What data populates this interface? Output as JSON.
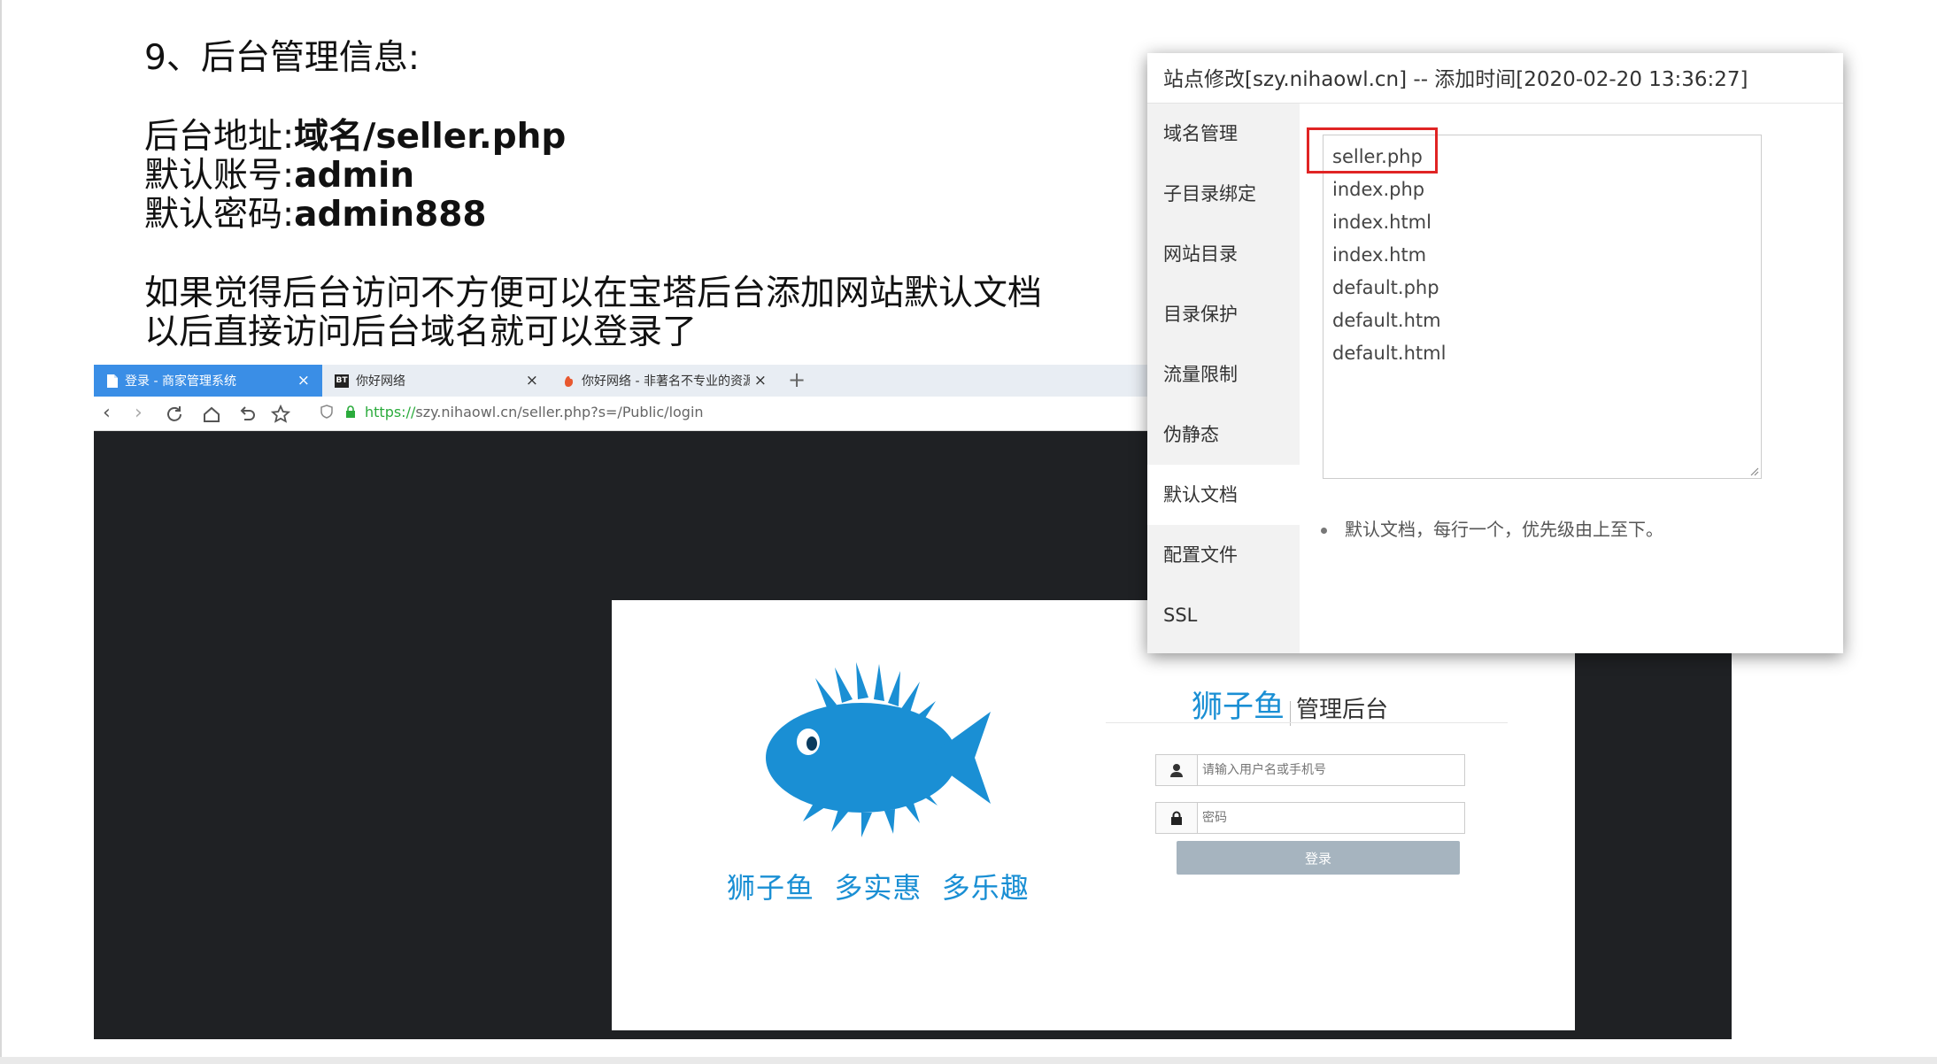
{
  "instructions": {
    "heading": "9、后台管理信息:",
    "address_label": "后台地址:",
    "address_value": "域名/seller.php",
    "account_label": "默认账号:",
    "account_value": "admin",
    "password_label": "默认密码:",
    "password_value": "admin888",
    "tip_line1": "如果觉得后台访问不方便可以在宝塔后台添加网站默认文档",
    "tip_line2": "以后直接访问后台域名就可以登录了"
  },
  "browser": {
    "tabs": [
      {
        "label": "登录 - 商家管理系统",
        "close": "×"
      },
      {
        "label": "你好网络",
        "close": "×"
      },
      {
        "label": "你好网络 - 非著名不专业的资源",
        "close": "×"
      }
    ],
    "new_tab": "+",
    "url_scheme": "https://",
    "url_rest": "szy.nihaowl.cn/seller.php?s=/Public/login"
  },
  "login": {
    "slogan": "狮子鱼  多实惠  多乐趣",
    "brand_name": "狮子鱼",
    "brand_suffix": "管理后台",
    "username_placeholder": "请输入用户名或手机号",
    "password_placeholder": "密码",
    "submit_label": "登录"
  },
  "dialog": {
    "title": "站点修改[szy.nihaowl.cn] -- 添加时间[2020-02-20 13:36:27]",
    "menu": [
      "域名管理",
      "子目录绑定",
      "网站目录",
      "目录保护",
      "流量限制",
      "伪静态",
      "默认文档",
      "配置文件",
      "SSL"
    ],
    "active_menu": "默认文档",
    "default_docs": [
      "seller.php",
      "index.php",
      "index.html",
      "index.htm",
      "default.php",
      "default.htm",
      "default.html"
    ],
    "note": "默认文档，每行一个，优先级由上至下。"
  },
  "colors": {
    "accent_blue": "#1a8fd4",
    "highlight_red": "#e02424",
    "tab_active": "#3a8ee6",
    "page_bg_dark": "#1f2124"
  }
}
